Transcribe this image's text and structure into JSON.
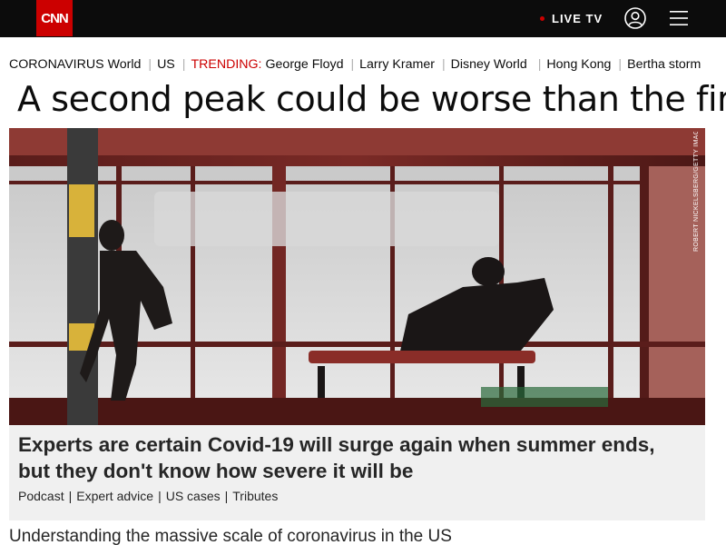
{
  "header": {
    "logo_text": "CNN",
    "live_tv_label": "LIVE TV",
    "icons": {
      "user": "user-account-icon",
      "menu": "hamburger-menu-icon"
    },
    "colors": {
      "bar": "#0c0c0c",
      "brand": "#cc0000"
    }
  },
  "trending_bar": {
    "coronavirus_label": "CORONAVIRUS",
    "coronavirus_links": [
      "World",
      "US"
    ],
    "trending_label": "TRENDING:",
    "trending_links": [
      "George Floyd",
      "Larry Kramer",
      "Disney World",
      "Hong Kong",
      "Bertha storm"
    ]
  },
  "headline": "A second peak could be worse than the first",
  "hero": {
    "photo_credit": "ROBERT NICKELSBERG/GETTY IMAGES",
    "caption_title": "Experts are certain Covid-19 will surge again when summer ends, but they don't know how severe it will be",
    "related_links": [
      "Podcast",
      "Expert advice",
      "US cases",
      "Tributes"
    ]
  },
  "subheadline": "Understanding the massive scale of coronavirus in the US"
}
